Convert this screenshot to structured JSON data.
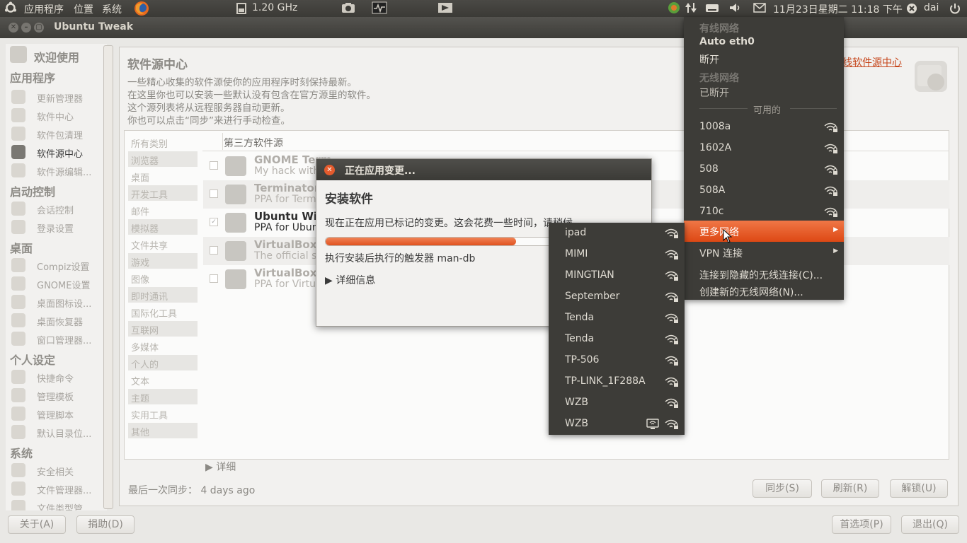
{
  "top_panel": {
    "menus": [
      "应用程序",
      "位置",
      "系统"
    ],
    "cpu_freq": "1.20 GHz",
    "datetime": "11月23日星期二 11:18 下午",
    "user": "dai"
  },
  "window": {
    "title": "Ubuntu Tweak"
  },
  "sidebar": {
    "items": [
      {
        "type": "section",
        "label": "欢迎使用"
      },
      {
        "type": "section",
        "label": "应用程序"
      },
      {
        "type": "item",
        "label": "更新管理器"
      },
      {
        "type": "item",
        "label": "软件中心"
      },
      {
        "type": "item",
        "label": "软件包清理"
      },
      {
        "type": "item",
        "label": "软件源中心",
        "selected": true
      },
      {
        "type": "item",
        "label": "软件源编辑..."
      },
      {
        "type": "section",
        "label": "启动控制"
      },
      {
        "type": "item",
        "label": "会话控制"
      },
      {
        "type": "item",
        "label": "登录设置"
      },
      {
        "type": "section",
        "label": "桌面"
      },
      {
        "type": "item",
        "label": "Compiz设置"
      },
      {
        "type": "item",
        "label": "GNOME设置"
      },
      {
        "type": "item",
        "label": "桌面图标设..."
      },
      {
        "type": "item",
        "label": "桌面恢复器"
      },
      {
        "type": "item",
        "label": "窗口管理器..."
      },
      {
        "type": "section",
        "label": "个人设定"
      },
      {
        "type": "item",
        "label": "快捷命令"
      },
      {
        "type": "item",
        "label": "管理模板"
      },
      {
        "type": "item",
        "label": "管理脚本"
      },
      {
        "type": "item",
        "label": "默认目录位..."
      },
      {
        "type": "section",
        "label": "系统"
      },
      {
        "type": "item",
        "label": "安全相关"
      },
      {
        "type": "item",
        "label": "文件管理器..."
      },
      {
        "type": "item",
        "label": "文件类型管"
      }
    ]
  },
  "main": {
    "title": "软件源中心",
    "description": [
      "一些精心收集的软件源使你的应用程序时刻保持最新。",
      "在这里你也可以安装一些默认没有包含在官方源里的软件。",
      "这个源列表将从远程服务器自动更新。",
      "你也可以点击“同步”来进行手动检查。"
    ],
    "online_link": "线软件源中心",
    "categories": [
      "所有类别",
      "浏览器",
      "桌面",
      "开发工具",
      "邮件",
      "模拟器",
      "文件共享",
      "游戏",
      "图像",
      "即时通讯",
      "国际化工具",
      "互联网",
      "多媒体",
      "个人的",
      "文本",
      "主题",
      "实用工具",
      "其他"
    ],
    "source_header": "第三方软件源",
    "sources": [
      {
        "name": "GNOME Term",
        "desc": "My hack with",
        "checked": false
      },
      {
        "name": "Terminator",
        "desc": "PPA for Term",
        "checked": false
      },
      {
        "name": "Ubuntu Wind",
        "desc": "PPA for Ubun",
        "checked": true
      },
      {
        "name": "VirtualBox O",
        "desc": "The official s",
        "checked": false
      },
      {
        "name": "VirtualBox O",
        "desc": "PPA for Virtu",
        "checked": false
      }
    ],
    "details_label": "详细",
    "last_sync_label": "最后一次同步：",
    "last_sync_value": "4 days ago",
    "buttons": {
      "sync": "同步(S)",
      "refresh": "刷新(R)",
      "unlock": "解锁(U)"
    }
  },
  "footer": {
    "about": "关于(A)",
    "donate": "捐助(D)",
    "preferences": "首选项(P)",
    "quit": "退出(Q)"
  },
  "dialog": {
    "title": "正在应用变更...",
    "heading": "安装软件",
    "message": "现在正在应用已标记的变更。这会花费一些时间，请稍候",
    "progress": 0.6,
    "status": "执行安装后执行的触发器 man-db",
    "details": "详细信息"
  },
  "network_menu": {
    "wired_header": "有线网络",
    "wired_conn": "Auto eth0",
    "wired_disconnect": "断开",
    "wireless_header": "无线网络",
    "wireless_status": "已断开",
    "available_label": "可用的",
    "networks": [
      "1008a",
      "1602A",
      "508",
      "508A",
      "710c"
    ],
    "more_networks": "更多网络",
    "vpn": "VPN 连接",
    "connect_hidden": "连接到隐藏的无线连接(C)...",
    "create_new": "创建新的无线网络(N)..."
  },
  "more_networks": [
    "ipad",
    "MIMI",
    "MINGTIAN",
    "September",
    "Tenda",
    "Tenda",
    "TP-506",
    "TP-LINK_1F288A",
    "WZB",
    "WZB"
  ],
  "colors": {
    "accent": "#dd4814",
    "panel": "#3d3c38",
    "link": "#c6451a"
  }
}
